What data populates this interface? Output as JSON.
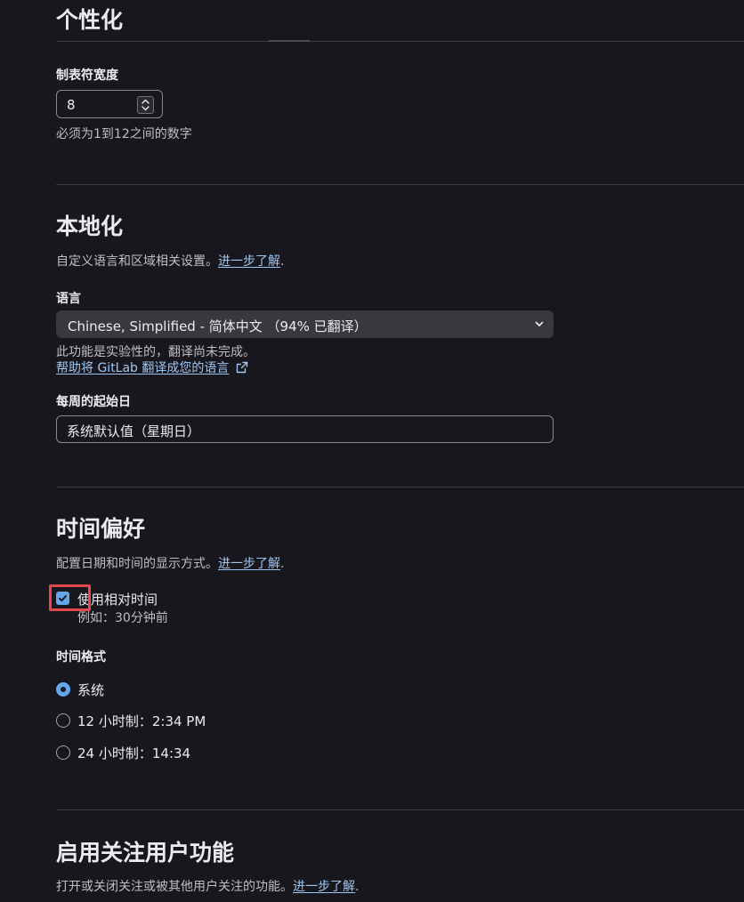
{
  "personalization": {
    "title": "个性化",
    "tab_width_label": "制表符宽度",
    "tab_width_value": "8",
    "tab_width_help": "必须为1到12之间的数字"
  },
  "localization": {
    "title": "本地化",
    "description": "自定义语言和区域相关设置。",
    "learn_more": "进一步了解",
    "period": ".",
    "language_label": "语言",
    "language_value": "Chinese, Simplified - 简体中文 （94% 已翻译）",
    "experimental_note": "此功能是实验性的，翻译尚未完成。",
    "help_translate_link": "帮助将 GitLab 翻译成您的语言",
    "first_day_label": "每周的起始日",
    "first_day_value": "系统默认值（星期日）"
  },
  "time_preferences": {
    "title": "时间偏好",
    "description": "配置日期和时间的显示方式。",
    "learn_more": "进一步了解",
    "period": ".",
    "relative_time_label": "使用相对时间",
    "relative_time_checked": true,
    "relative_time_example": "例如：30分钟前",
    "time_format_label": "时间格式",
    "options": [
      {
        "label": "系统",
        "selected": true
      },
      {
        "label": "12 小时制：2:34 PM",
        "selected": false
      },
      {
        "label": "24 小时制：14:34",
        "selected": false
      }
    ]
  },
  "follow_users": {
    "title": "启用关注用户功能",
    "description": "打开或关闭关注或被其他用户关注的功能。",
    "learn_more": "进一步了解",
    "period": "."
  },
  "colors": {
    "background": "#18171d",
    "link": "#9dc7f1",
    "accent": "#63a6e9",
    "highlight": "#e5484d"
  },
  "icons": {
    "spinner": "up-down-stepper-icon",
    "dropdown": "chevron-down-icon",
    "external_link": "external-link-icon",
    "check": "check-icon"
  }
}
